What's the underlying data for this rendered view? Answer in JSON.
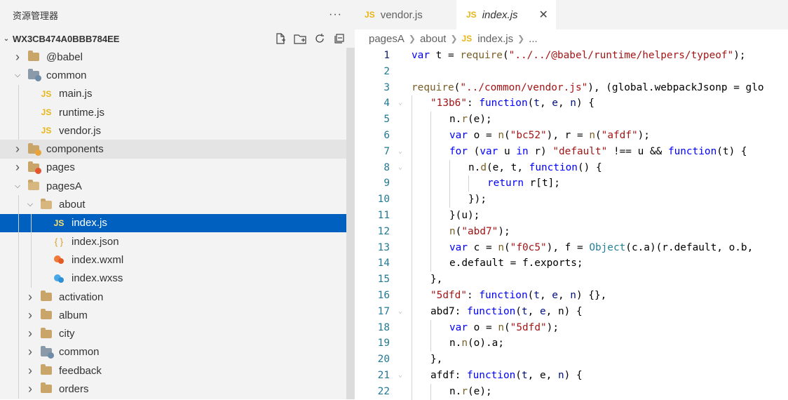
{
  "sidebar": {
    "title": "资源管理器",
    "more": "···",
    "project": "WX3CB474A0BBB784EE",
    "tree": [
      {
        "label": "@babel",
        "type": "folder",
        "depth": 0,
        "state": "collapsed"
      },
      {
        "label": "common",
        "type": "folder-gray",
        "depth": 0,
        "state": "expanded"
      },
      {
        "label": "main.js",
        "type": "js",
        "depth": 1
      },
      {
        "label": "runtime.js",
        "type": "js",
        "depth": 1
      },
      {
        "label": "vendor.js",
        "type": "js",
        "depth": 1
      },
      {
        "label": "components",
        "type": "folder-special",
        "depth": 0,
        "state": "collapsed"
      },
      {
        "label": "pages",
        "type": "folder-red",
        "depth": 0,
        "state": "collapsed"
      },
      {
        "label": "pagesA",
        "type": "folder",
        "depth": 0,
        "state": "expanded"
      },
      {
        "label": "about",
        "type": "folder",
        "depth": 1,
        "state": "expanded"
      },
      {
        "label": "index.js",
        "type": "js",
        "depth": 2,
        "selected": true
      },
      {
        "label": "index.json",
        "type": "json",
        "depth": 2
      },
      {
        "label": "index.wxml",
        "type": "wxml",
        "depth": 2
      },
      {
        "label": "index.wxss",
        "type": "wxss",
        "depth": 2
      },
      {
        "label": "activation",
        "type": "folder",
        "depth": 1,
        "state": "collapsed"
      },
      {
        "label": "album",
        "type": "folder",
        "depth": 1,
        "state": "collapsed"
      },
      {
        "label": "city",
        "type": "folder",
        "depth": 1,
        "state": "collapsed"
      },
      {
        "label": "common",
        "type": "folder-gray",
        "depth": 1,
        "state": "collapsed"
      },
      {
        "label": "feedback",
        "type": "folder",
        "depth": 1,
        "state": "collapsed"
      },
      {
        "label": "orders",
        "type": "folder",
        "depth": 1,
        "state": "collapsed"
      }
    ]
  },
  "tabs": [
    {
      "label": "vendor.js",
      "icon": "JS",
      "active": false
    },
    {
      "label": "index.js",
      "icon": "JS",
      "active": true,
      "close": "✕"
    }
  ],
  "breadcrumb": {
    "items": [
      "pagesA",
      "about"
    ],
    "file": "index.js",
    "icon": "JS",
    "ellipsis": "..."
  },
  "code_lines": [
    {
      "n": 1,
      "ind": 0,
      "fold": "",
      "html": "<span class='k'>var</span> t = <span class='f'>require</span>(<span class='s'>\"../../@babel/runtime/helpers/typeof\"</span>);"
    },
    {
      "n": 2,
      "ind": 0,
      "fold": "",
      "html": ""
    },
    {
      "n": 3,
      "ind": 0,
      "fold": "",
      "html": "<span class='f'>require</span>(<span class='s'>\"../common/vendor.js\"</span>), (global.webpackJsonp = glo"
    },
    {
      "n": 4,
      "ind": 1,
      "fold": "⌄",
      "html": "<span class='s'>\"13b6\"</span>: <span class='k'>function</span>(<span class='p'>t</span>, <span class='p'>e</span>, <span class='p'>n</span>) {"
    },
    {
      "n": 5,
      "ind": 2,
      "fold": "",
      "html": "n.<span class='f'>r</span>(e);"
    },
    {
      "n": 6,
      "ind": 2,
      "fold": "",
      "html": "<span class='k'>var</span> o = <span class='f'>n</span>(<span class='s'>\"bc52\"</span>), r = <span class='f'>n</span>(<span class='s'>\"afdf\"</span>);"
    },
    {
      "n": 7,
      "ind": 2,
      "fold": "⌄",
      "html": "<span class='k'>for</span> (<span class='k'>var</span> u <span class='k'>in</span> r) <span class='s'>\"default\"</span> !== u &amp;&amp; <span class='k'>function</span>(t) {"
    },
    {
      "n": 8,
      "ind": 3,
      "fold": "⌄",
      "html": "n.<span class='f'>d</span>(e, t, <span class='k'>function</span>() {"
    },
    {
      "n": 9,
      "ind": 4,
      "fold": "",
      "html": "<span class='k'>return</span> r[t];"
    },
    {
      "n": 10,
      "ind": 3,
      "fold": "",
      "html": "});"
    },
    {
      "n": 11,
      "ind": 2,
      "fold": "",
      "html": "}(u);"
    },
    {
      "n": 12,
      "ind": 2,
      "fold": "",
      "html": "<span class='f'>n</span>(<span class='s'>\"abd7\"</span>);"
    },
    {
      "n": 13,
      "ind": 2,
      "fold": "",
      "html": "<span class='k'>var</span> c = <span class='f'>n</span>(<span class='s'>\"f0c5\"</span>), f = <span class='t'>Object</span>(c.a)(r.default, o.b,"
    },
    {
      "n": 14,
      "ind": 2,
      "fold": "",
      "html": "e.default = f.exports;"
    },
    {
      "n": 15,
      "ind": 1,
      "fold": "",
      "html": "},"
    },
    {
      "n": 16,
      "ind": 1,
      "fold": "",
      "html": "<span class='s'>\"5dfd\"</span>: <span class='k'>function</span>(<span class='p'>t</span>, <span class='p'>e</span>, <span class='p'>n</span>) {},"
    },
    {
      "n": 17,
      "ind": 1,
      "fold": "⌄",
      "html": "abd7: <span class='k'>function</span>(<span class='p'>t</span>, <span class='p'>e</span>, n) {"
    },
    {
      "n": 18,
      "ind": 2,
      "fold": "",
      "html": "<span class='k'>var</span> o = <span class='f'>n</span>(<span class='s'>\"5dfd\"</span>);"
    },
    {
      "n": 19,
      "ind": 2,
      "fold": "",
      "html": "n.<span class='f'>n</span>(o).a;"
    },
    {
      "n": 20,
      "ind": 1,
      "fold": "",
      "html": "},"
    },
    {
      "n": 21,
      "ind": 1,
      "fold": "⌄",
      "html": "afdf: <span class='k'>function</span>(<span class='p'>t</span>, e, <span class='p'>n</span>) {"
    },
    {
      "n": 22,
      "ind": 2,
      "fold": "",
      "html": "n.<span class='f'>r</span>(e);"
    }
  ],
  "colors": {
    "accent": "#0060c0",
    "js_icon": "#e8b515",
    "line_number": "#237893"
  }
}
